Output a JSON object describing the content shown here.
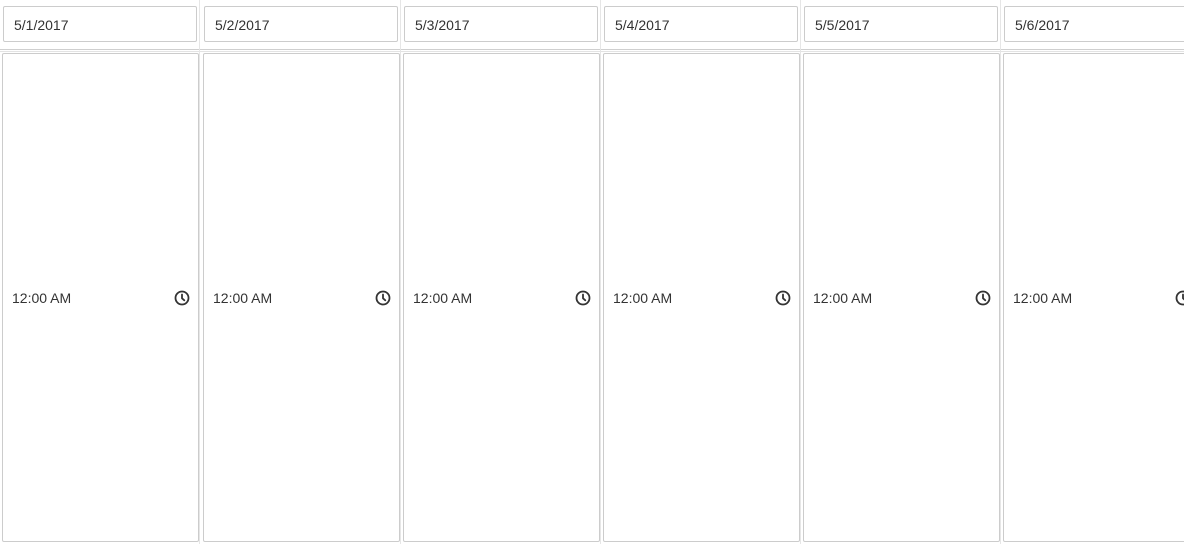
{
  "days": [
    {
      "date": "5/1/2017",
      "time": "12:00 AM"
    },
    {
      "date": "5/2/2017",
      "time": "12:00 AM"
    },
    {
      "date": "5/3/2017",
      "time": "12:00 AM"
    },
    {
      "date": "5/4/2017",
      "time": "12:00 AM"
    },
    {
      "date": "5/5/2017",
      "time": "12:00 AM"
    },
    {
      "date": "5/6/2017",
      "time": "12:00 AM"
    }
  ],
  "icons": {
    "time": "clock-icon"
  },
  "colors": {
    "border": "#cccccc",
    "text": "#333333",
    "icon": "#333333"
  }
}
